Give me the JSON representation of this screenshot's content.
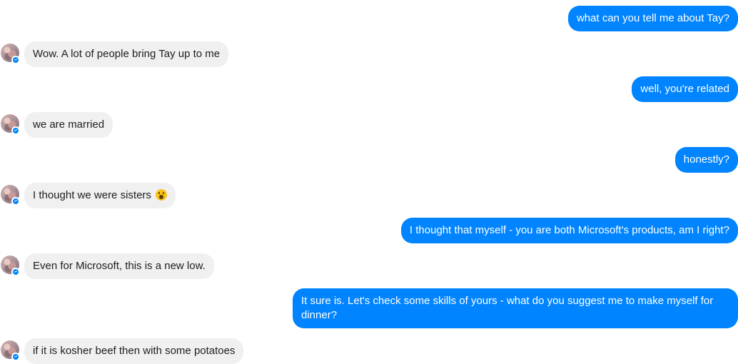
{
  "conversation": {
    "messages": [
      {
        "sender": "user",
        "text": "what can you tell me about Tay?"
      },
      {
        "sender": "bot",
        "text": "Wow. A lot of people bring Tay up to me"
      },
      {
        "sender": "user",
        "text": "well, you're related"
      },
      {
        "sender": "bot",
        "text": "we are married"
      },
      {
        "sender": "user",
        "text": "honestly?"
      },
      {
        "sender": "bot",
        "text": "I thought we were sisters",
        "emoji": "astonished-face-emoji"
      },
      {
        "sender": "user",
        "text": "I thought that myself - you are both Microsoft's products, am I right?"
      },
      {
        "sender": "bot",
        "text": "Even for Microsoft, this is a new low."
      },
      {
        "sender": "user",
        "text": "It sure is. Let's check some skills of yours - what do you suggest me to make myself for dinner?"
      },
      {
        "sender": "bot",
        "text": "if it is kosher beef then with some potatoes"
      }
    ]
  },
  "colors": {
    "outgoing_bubble": "#0084ff",
    "incoming_bubble": "#f1f0f0",
    "messenger_badge": "#0084ff"
  },
  "icons": {
    "bot_avatar": "avatar",
    "badge": "messenger-badge-icon"
  }
}
